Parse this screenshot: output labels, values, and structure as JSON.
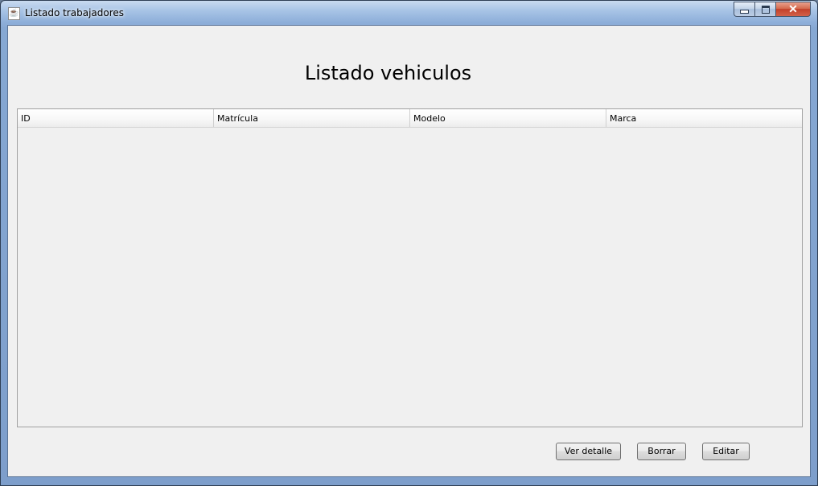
{
  "window": {
    "title": "Listado trabajadores",
    "app_icon": "java-cup-icon",
    "controls": {
      "minimize_icon": "minimize-icon",
      "maximize_icon": "maximize-icon",
      "close_icon": "close-icon",
      "close_glyph": "✕"
    }
  },
  "main": {
    "heading": "Listado vehiculos",
    "table": {
      "columns": [
        "ID",
        "Matrícula",
        "Modelo",
        "Marca"
      ],
      "rows": []
    },
    "buttons": {
      "detail_label": "Ver detalle",
      "delete_label": "Borrar",
      "edit_label": "Editar"
    }
  },
  "colors": {
    "client_background": "#f0f0f0",
    "title_gradient_top": "#c9dbf0",
    "close_button": "#c2402a"
  }
}
